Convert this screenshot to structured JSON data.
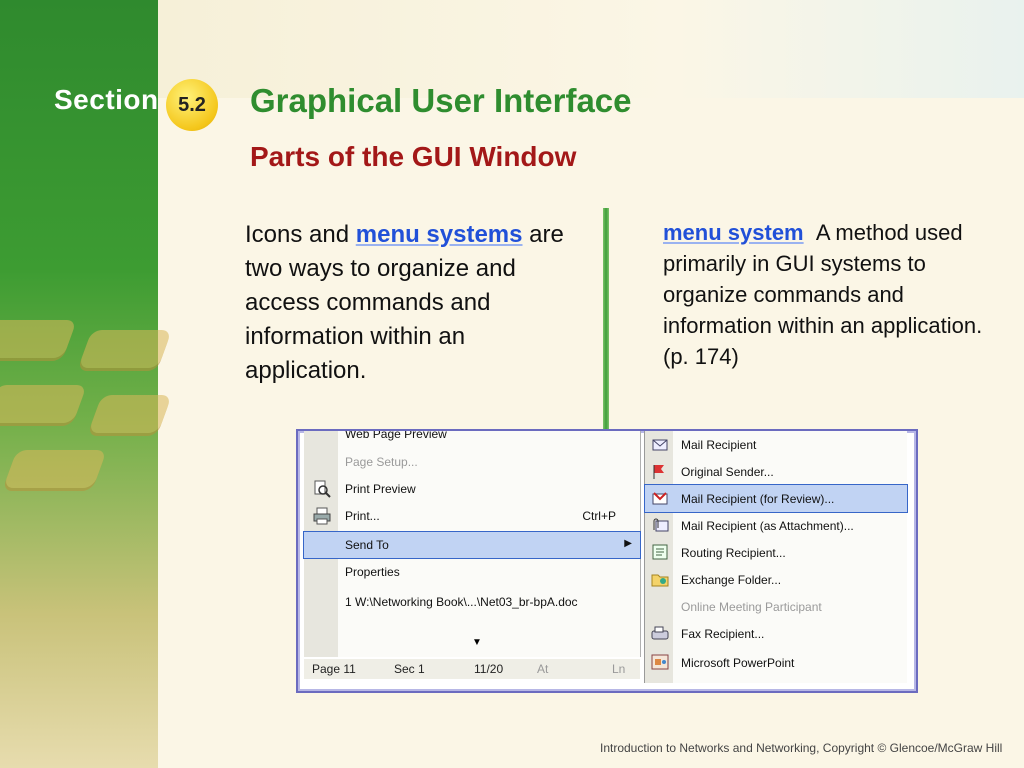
{
  "header": {
    "section_word": "Section",
    "badge": "5.2",
    "title": "Graphical User Interface",
    "subtitle": "Parts of the GUI Window"
  },
  "body": {
    "text_before": "Icons and ",
    "keyword": "menu systems",
    "text_after": " are two ways to organize and access commands and information within an application."
  },
  "definition": {
    "term": "menu system",
    "text": "A method used primarily in GUI systems to organize commands and information within an application. (p. 174)"
  },
  "screenshot": {
    "menu_items": [
      {
        "label": "Web Page Preview",
        "disabled": false
      },
      {
        "label": "Page Setup...",
        "disabled": true
      },
      {
        "label": "Print Preview",
        "disabled": false
      },
      {
        "label": "Print...",
        "shortcut": "Ctrl+P",
        "disabled": false
      },
      {
        "label": "Send To",
        "selected": true
      },
      {
        "label": "Properties",
        "disabled": false
      },
      {
        "label": "1 W:\\Networking Book\\...\\Net03_br-bpA.doc",
        "disabled": false
      }
    ],
    "status_bar": {
      "page": "Page  11",
      "sec": "Sec  1",
      "pos": "11/20",
      "at": "At",
      "ln": "Ln"
    },
    "submenu_items": [
      {
        "label": "Mail Recipient"
      },
      {
        "label": "Original Sender..."
      },
      {
        "label": "Mail Recipient (for Review)...",
        "selected": true
      },
      {
        "label": "Mail Recipient (as Attachment)..."
      },
      {
        "label": "Routing Recipient..."
      },
      {
        "label": "Exchange Folder..."
      },
      {
        "label": "Online Meeting Participant",
        "disabled": true
      },
      {
        "label": "Fax Recipient..."
      },
      {
        "label": "Microsoft PowerPoint"
      }
    ]
  },
  "footer": "Introduction to Networks and Networking, Copyright © Glencoe/McGraw Hill",
  "colors": {
    "title": "#2f8d2f",
    "subtitle": "#a31818",
    "keyword": "#2150d8",
    "sidebar": "#3d9c32"
  }
}
